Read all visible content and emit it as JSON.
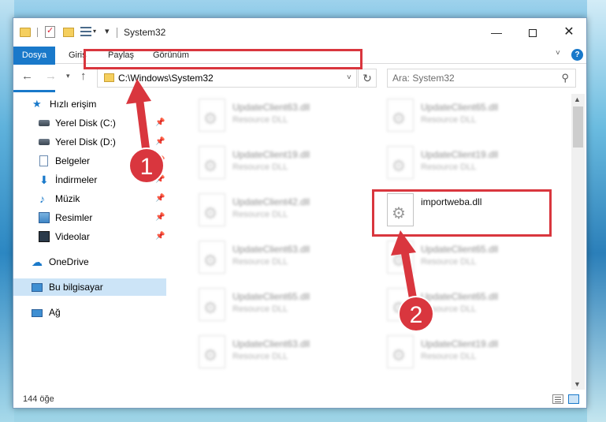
{
  "window": {
    "title": "System32",
    "min_glyph": "—",
    "close_glyph": "✕"
  },
  "ribbon": {
    "tabs": [
      "Dosya",
      "Giriş",
      "Paylaş",
      "Görünüm"
    ],
    "help_glyph": "?"
  },
  "nav": {
    "address": "C:\\Windows\\System32",
    "search_placeholder": "Ara: System32"
  },
  "sidebar": {
    "items": [
      {
        "label": "Hızlı erişim",
        "icon": "star-icon"
      },
      {
        "label": "Yerel Disk (C:)",
        "icon": "disk-icon",
        "pinned": true
      },
      {
        "label": "Yerel Disk (D:)",
        "icon": "disk-icon",
        "pinned": true
      },
      {
        "label": "Belgeler",
        "icon": "document-icon",
        "pinned": true
      },
      {
        "label": "İndirmeler",
        "icon": "download-icon",
        "pinned": true
      },
      {
        "label": "Müzik",
        "icon": "music-icon",
        "pinned": true
      },
      {
        "label": "Resimler",
        "icon": "pictures-icon",
        "pinned": true
      },
      {
        "label": "Videolar",
        "icon": "video-icon",
        "pinned": true
      },
      {
        "label": "OneDrive",
        "icon": "cloud-icon"
      },
      {
        "label": "Bu bilgisayar",
        "icon": "computer-icon",
        "selected": true
      },
      {
        "label": "Ağ",
        "icon": "network-icon"
      }
    ]
  },
  "files": [
    {
      "name": "UpdateClient63.dll",
      "type": "Resource DLL"
    },
    {
      "name": "UpdateClient65.dll",
      "type": "Resource DLL"
    },
    {
      "name": "UpdateClient19.dll",
      "type": "Resource DLL"
    },
    {
      "name": "UpdateClient19.dll",
      "type": "Resource DLL"
    },
    {
      "name": "UpdateClient42.dll",
      "type": "Resource DLL"
    },
    {
      "name": "importweba.dll",
      "type": ""
    },
    {
      "name": "UpdateClient63.dll",
      "type": "Resource DLL"
    },
    {
      "name": "UpdateClient65.dll",
      "type": "Resource DLL"
    },
    {
      "name": "UpdateClient65.dll",
      "type": "Resource DLL"
    },
    {
      "name": "UpdateClient65.dll",
      "type": "Resource DLL"
    },
    {
      "name": "UpdateClient63.dll",
      "type": "Resource DLL"
    },
    {
      "name": "UpdateClient19.dll",
      "type": "Resource DLL"
    }
  ],
  "status": {
    "item_count": "144 öğe"
  },
  "annotations": {
    "marker1": "1",
    "marker2": "2",
    "color": "#d9363e"
  }
}
